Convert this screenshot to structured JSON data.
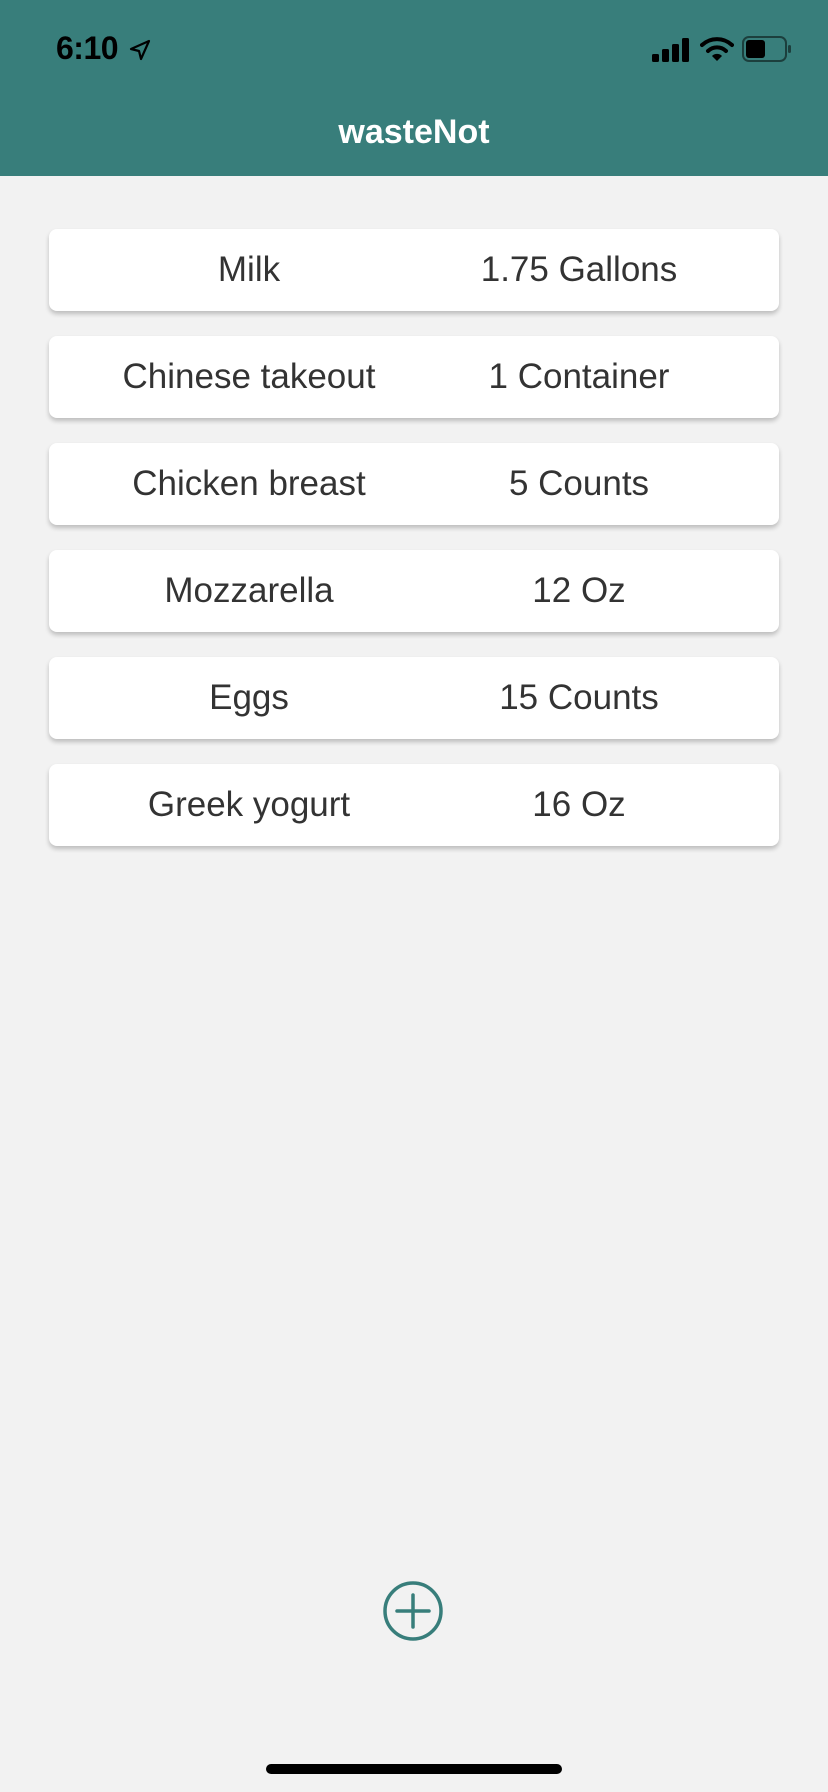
{
  "status_bar": {
    "time": "6:10"
  },
  "header": {
    "title": "wasteNot",
    "background": "#387e7b"
  },
  "items": [
    {
      "name": "Milk",
      "quantity": "1.75 Gallons"
    },
    {
      "name": "Chinese takeout",
      "quantity": "1 Container"
    },
    {
      "name": "Chicken breast",
      "quantity": "5 Counts"
    },
    {
      "name": "Mozzarella",
      "quantity": "12 Oz"
    },
    {
      "name": "Eggs",
      "quantity": "15 Counts"
    },
    {
      "name": "Greek yogurt",
      "quantity": "16 Oz"
    }
  ],
  "icons": {
    "add": "plus-circle-icon",
    "location": "location-arrow-icon",
    "signal": "cellular-signal-icon",
    "wifi": "wifi-icon",
    "battery": "battery-icon"
  },
  "colors": {
    "accent": "#387e7b",
    "background": "#f2f2f2",
    "card": "#ffffff",
    "text": "#333333"
  }
}
